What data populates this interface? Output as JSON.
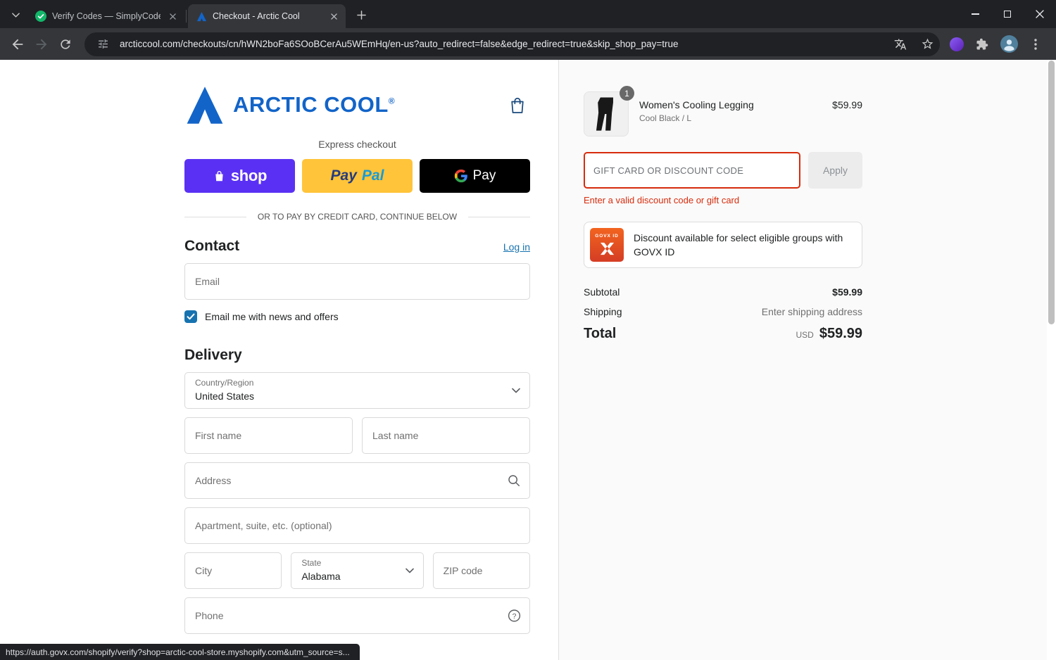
{
  "browser": {
    "tabs": [
      {
        "title": "Verify Codes — SimplyCodes"
      },
      {
        "title": "Checkout - Arctic Cool"
      }
    ],
    "url": "arcticcool.com/checkouts/cn/hWN2boFa6SOoBCerAu5WEmHq/en-us?auto_redirect=false&edge_redirect=true&skip_shop_pay=true",
    "status_link": "https://auth.govx.com/shopify/verify?shop=arctic-cool-store.myshopify.com&utm_source=s..."
  },
  "header": {
    "brand": "ARCTIC COOL",
    "registered": "®"
  },
  "express": {
    "title": "Express checkout",
    "shop_label": "shop",
    "paypal_pay": "Pay",
    "paypal_pal": "Pal",
    "gpay_label": "Pay",
    "divider": "OR TO PAY BY CREDIT CARD, CONTINUE BELOW"
  },
  "contact": {
    "title": "Contact",
    "login_label": "Log in",
    "email_placeholder": "Email",
    "newsletter_label": "Email me with news and offers",
    "newsletter_checked": true
  },
  "delivery": {
    "title": "Delivery",
    "country_label": "Country/Region",
    "country_value": "United States",
    "first_name_placeholder": "First name",
    "last_name_placeholder": "Last name",
    "address_placeholder": "Address",
    "apartment_placeholder": "Apartment, suite, etc. (optional)",
    "city_placeholder": "City",
    "state_label": "State",
    "state_value": "Alabama",
    "zip_placeholder": "ZIP code",
    "phone_placeholder": "Phone"
  },
  "summary": {
    "item": {
      "quantity": "1",
      "name": "Women's Cooling Legging",
      "variant": "Cool Black / L",
      "price": "$59.99"
    },
    "discount": {
      "placeholder": "GIFT CARD OR DISCOUNT CODE",
      "apply_label": "Apply",
      "error": "Enter a valid discount code or gift card"
    },
    "govx": {
      "logo_text": "GOVX ID",
      "text": "Discount available for select eligible groups with GOVX ID"
    },
    "totals": {
      "subtotal_label": "Subtotal",
      "subtotal_value": "$59.99",
      "shipping_label": "Shipping",
      "shipping_value": "Enter shipping address",
      "total_label": "Total",
      "currency": "USD",
      "total_value": "$59.99"
    }
  },
  "colors": {
    "brand_blue": "#1264c8",
    "shop_purple": "#5a31f4",
    "paypal_yellow": "#ffc439",
    "gpay_black": "#000000",
    "accent_blue": "#1773b0",
    "error_red": "#d72c0d",
    "sidebar_bg": "#fafafa"
  }
}
